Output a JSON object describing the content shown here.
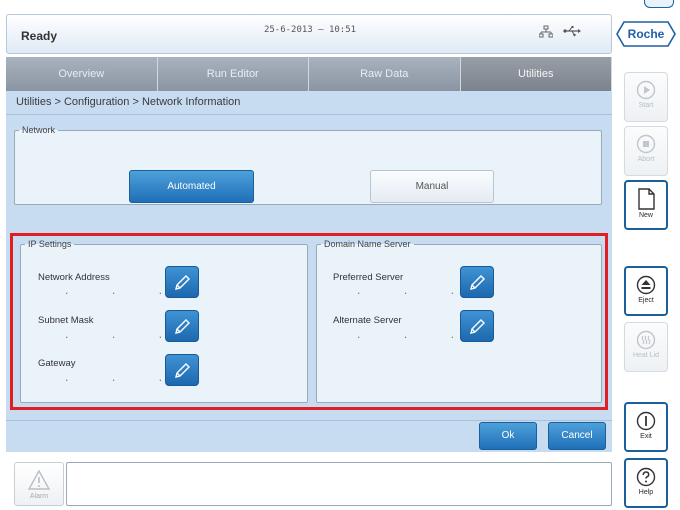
{
  "header": {
    "status": "Ready",
    "datetime": "25-6-2013 – 10:51",
    "logo": "Roche",
    "icons": [
      "network-icon",
      "usb-icon"
    ]
  },
  "tabs": [
    {
      "label": "Overview",
      "active": false
    },
    {
      "label": "Run Editor",
      "active": false
    },
    {
      "label": "Raw Data",
      "active": false
    },
    {
      "label": "Utilities",
      "active": true
    }
  ],
  "breadcrumb": "Utilities > Configuration > Network Information",
  "network": {
    "legend": "Network",
    "automated_label": "Automated",
    "manual_label": "Manual",
    "selected": "Automated"
  },
  "ip_settings": {
    "legend": "IP Settings",
    "fields": [
      {
        "label": "Network Address",
        "value": ". . ."
      },
      {
        "label": "Subnet Mask",
        "value": ". . ."
      },
      {
        "label": "Gateway",
        "value": ". . ."
      }
    ]
  },
  "dns": {
    "legend": "Domain Name Server",
    "fields": [
      {
        "label": "Preferred Server",
        "value": ". . ."
      },
      {
        "label": "Alternate Server",
        "value": ". . ."
      }
    ]
  },
  "footer": {
    "ok_label": "Ok",
    "cancel_label": "Cancel",
    "alarm_label": "Alarm",
    "message": ""
  },
  "side_buttons": [
    {
      "label": "Start",
      "icon": "play-icon",
      "enabled": false
    },
    {
      "label": "Abort",
      "icon": "stop-icon",
      "enabled": false
    },
    {
      "label": "New",
      "icon": "new-document-icon",
      "enabled": true
    },
    {
      "label": "Eject",
      "icon": "eject-icon",
      "enabled": true
    },
    {
      "label": "Heat Lid",
      "icon": "heat-lid-icon",
      "enabled": false
    },
    {
      "label": "Exit",
      "icon": "exit-icon",
      "enabled": true
    },
    {
      "label": "Help",
      "icon": "help-icon",
      "enabled": true
    }
  ],
  "colors": {
    "accent": "#1f6fb8",
    "panel": "#c7dcf1",
    "highlight": "#e01e24"
  }
}
